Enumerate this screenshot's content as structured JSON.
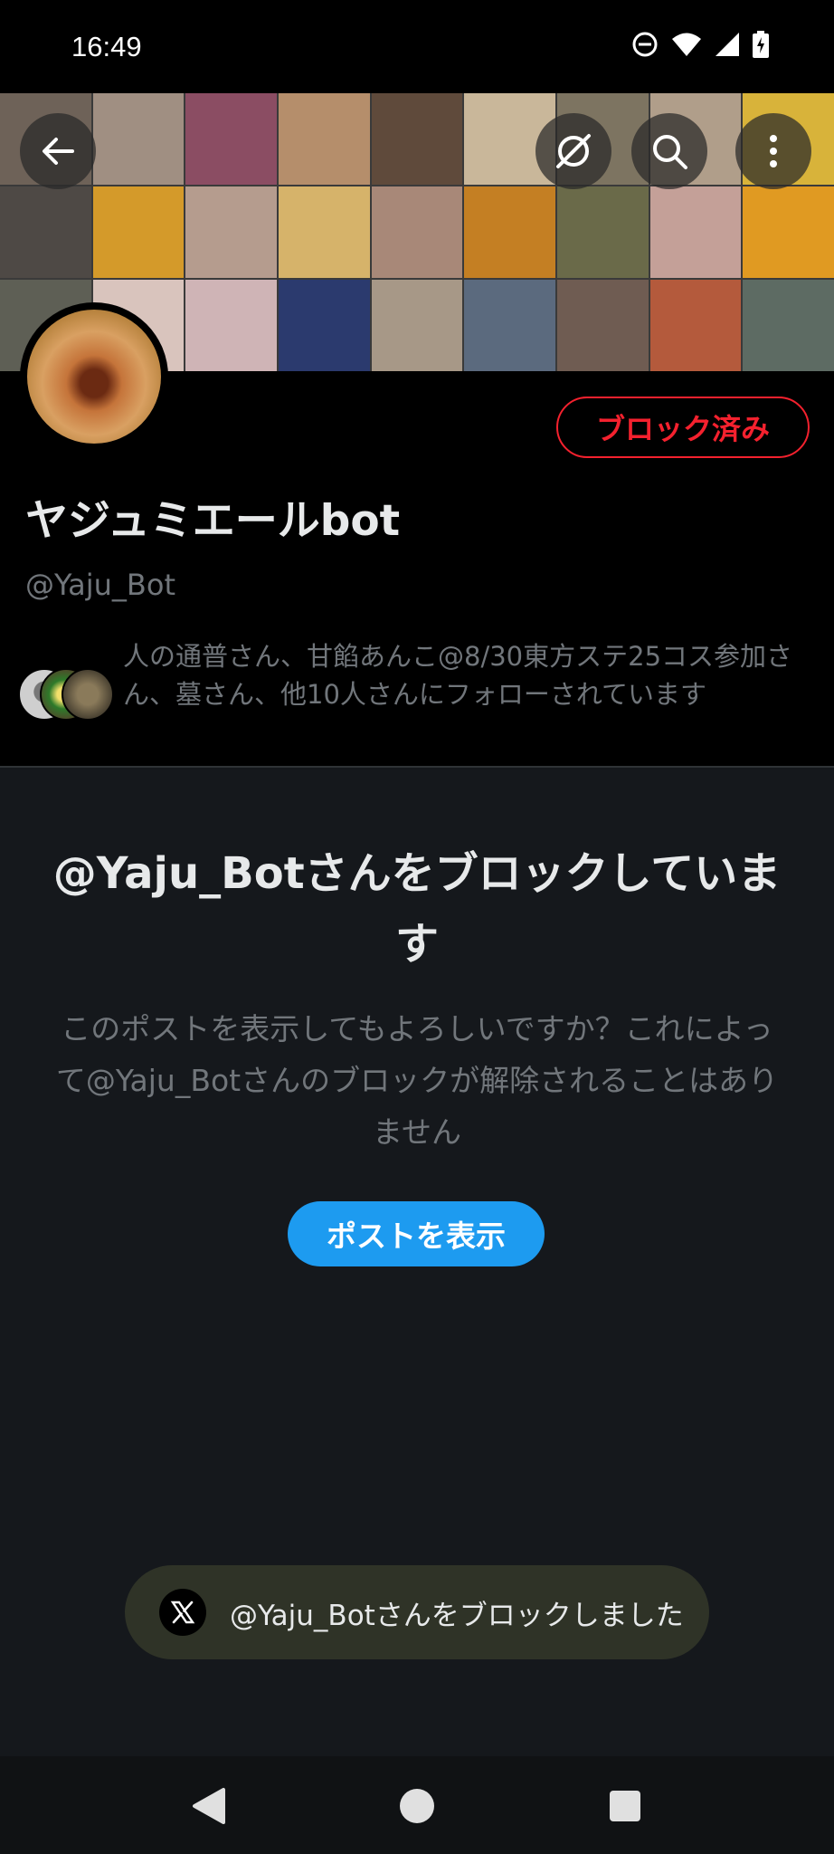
{
  "status_bar": {
    "time": "16:49"
  },
  "header": {
    "back_icon": "arrow-left-icon",
    "grok_icon": "slashed-circle-icon",
    "search_icon": "search-icon",
    "more_icon": "more-vert-icon"
  },
  "profile": {
    "blocked_label": "ブロック済み",
    "display_name": "ヤジュミエールbot",
    "handle": "@Yaju_Bot",
    "followed_by": "人の通普さん、甘餡あんこ@8/30東方ステ25コス参加さん、墓さん、他10人さんにフォローされています"
  },
  "blocked_notice": {
    "title": "@Yaju_Botさんをブロックしています",
    "description": "このポストを表示してもよろしいですか？これによって@Yaju_Botさんのブロックが解除されることはありません",
    "show_button": "ポストを表示"
  },
  "toast": {
    "icon": "x-logo-icon",
    "message": "@Yaju_Botさんをブロックしました"
  },
  "colors": {
    "accent": "#1d9bf0",
    "danger": "#f4212e",
    "background": "#15181c"
  }
}
